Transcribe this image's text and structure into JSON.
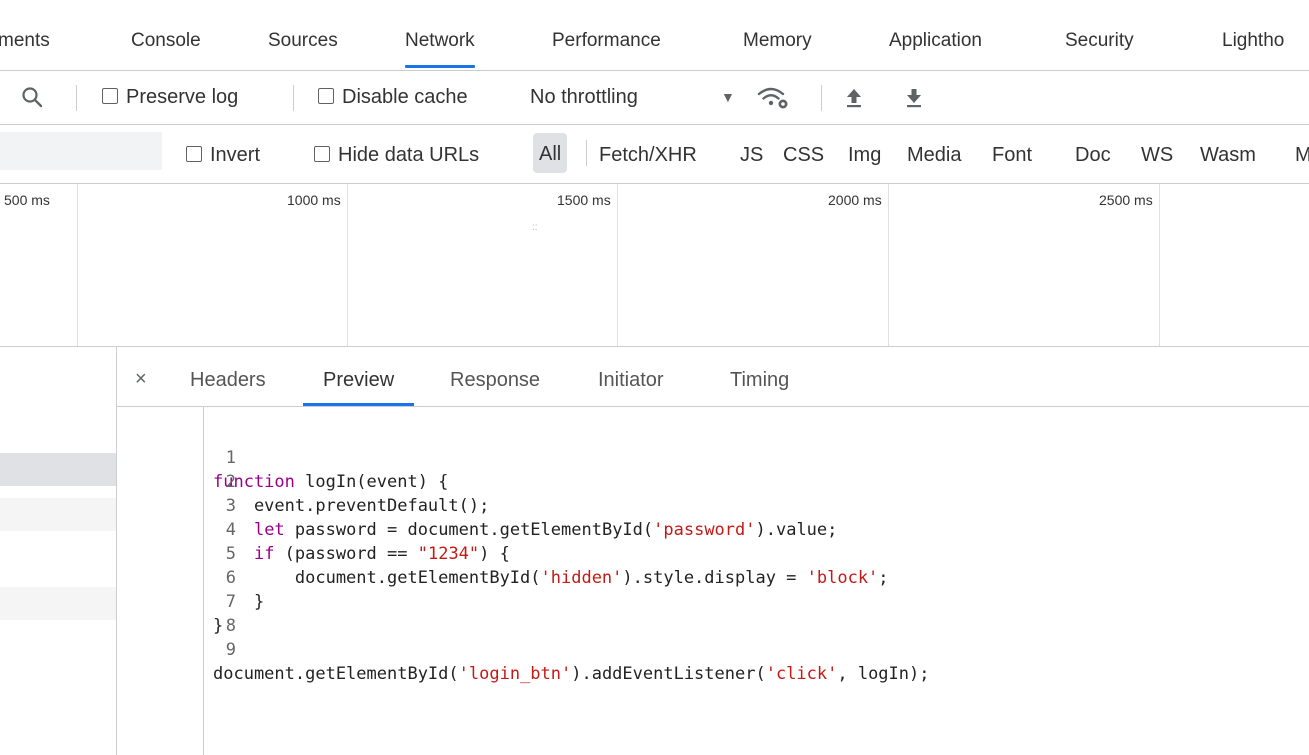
{
  "tabs": [
    {
      "label": "ments",
      "active": false
    },
    {
      "label": "Console",
      "active": false
    },
    {
      "label": "Sources",
      "active": false
    },
    {
      "label": "Network",
      "active": true
    },
    {
      "label": "Performance",
      "active": false
    },
    {
      "label": "Memory",
      "active": false
    },
    {
      "label": "Application",
      "active": false
    },
    {
      "label": "Security",
      "active": false
    },
    {
      "label": "Lightho",
      "active": false
    }
  ],
  "toolbar": {
    "preserve_log": "Preserve log",
    "disable_cache": "Disable cache",
    "throttling": "No throttling",
    "throttle_arrow": "▼"
  },
  "filter": {
    "input_value": "",
    "invert": "Invert",
    "hide_data_urls": "Hide data URLs",
    "types": [
      "All",
      "Fetch/XHR",
      "JS",
      "CSS",
      "Img",
      "Media",
      "Font",
      "Doc",
      "WS",
      "Wasm",
      "M"
    ]
  },
  "timeline": {
    "ticks": [
      "500 ms",
      "1000 ms",
      "1500 ms",
      "2000 ms",
      "2500 ms"
    ],
    "marker": "::"
  },
  "detail": {
    "close": "×",
    "tabs": [
      "Headers",
      "Preview",
      "Response",
      "Initiator",
      "Timing"
    ],
    "active_tab": "Preview"
  },
  "code": {
    "line_numbers": [
      "1",
      "2",
      "3",
      "4",
      "5",
      "6",
      "7",
      "8",
      "9"
    ],
    "l1": {
      "kw": "function",
      "rest": " logIn(event) {"
    },
    "l2": {
      "text": "    event.preventDefault();"
    },
    "l3": {
      "indent": "    ",
      "kw": "let",
      "a": " password = document.getElementById(",
      "s": "'password'",
      "b": ").value;"
    },
    "l4": {
      "indent": "    ",
      "kw": "if",
      "a": " (password == ",
      "s": "\"1234\"",
      "b": ") {"
    },
    "l5": {
      "a": "        document.getElementById(",
      "s1": "'hidden'",
      "b": ").style.display = ",
      "s2": "'block'",
      "c": ";"
    },
    "l6": {
      "text": "    }"
    },
    "l7": {
      "text": "}"
    },
    "l8": {
      "text": ""
    },
    "l9": {
      "a": "document.getElementById(",
      "s1": "'login_btn'",
      "b": ").addEventListener(",
      "s2": "'click'",
      "c": ", logIn);"
    }
  },
  "colors": {
    "accent": "#1a73e8",
    "keyword": "#9a0089",
    "string": "#c41a16",
    "selected_row": "#dfe1e5",
    "stripe_row": "#f5f5f5"
  }
}
